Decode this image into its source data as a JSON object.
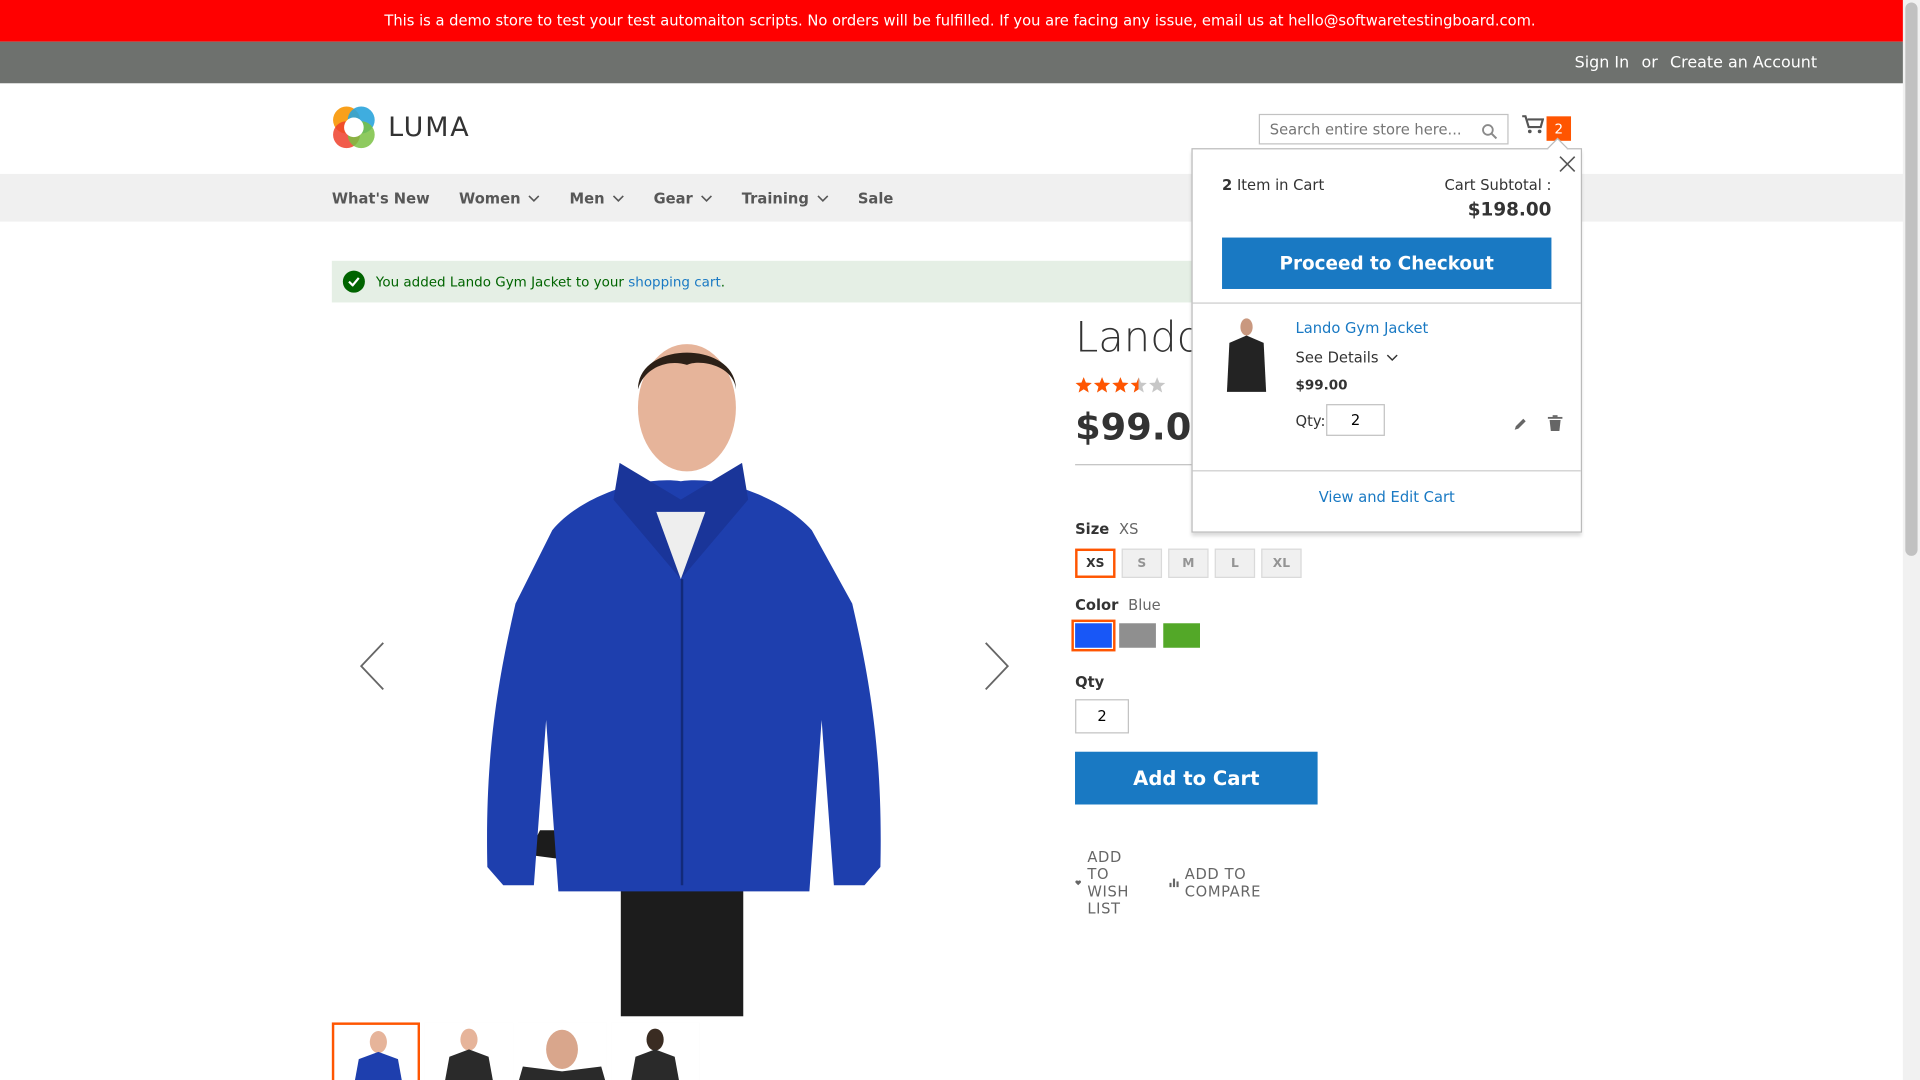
{
  "banner": {
    "text": "This is a demo store to test your test automaiton scripts. No orders will be fulfilled. If you are facing any issue, email us at hello@softwaretestingboard.com."
  },
  "header": {
    "sign_in": "Sign In",
    "or": "or",
    "create_account": "Create an Account",
    "logo_text": "LUMA",
    "search_placeholder": "Search entire store here...",
    "cart_count": "2"
  },
  "nav": {
    "items": [
      {
        "label": "What's New"
      },
      {
        "label": "Women"
      },
      {
        "label": "Men"
      },
      {
        "label": "Gear"
      },
      {
        "label": "Training"
      },
      {
        "label": "Sale"
      }
    ]
  },
  "message": {
    "prefix": "You added Lando Gym Jacket to your ",
    "link": "shopping cart",
    "suffix": "."
  },
  "product": {
    "title": "Lando",
    "rating": 0.7,
    "price": "$99.00",
    "size_label": "Size",
    "size_selected": "XS",
    "sizes": [
      "XS",
      "S",
      "M",
      "L",
      "XL"
    ],
    "color_label": "Color",
    "color_selected": "Blue",
    "colors": [
      "#1857f7",
      "#8f8f8f",
      "#53a828"
    ],
    "qty_label": "Qty",
    "qty_value": "2",
    "add_to_cart": "Add to Cart",
    "wishlist": "ADD TO WISH LIST",
    "compare": "ADD TO COMPARE"
  },
  "minicart": {
    "count": "2",
    "count_suffix": " Item in Cart",
    "subtotal_label": "Cart Subtotal :",
    "subtotal": "$198.00",
    "checkout": "Proceed to Checkout",
    "item_name": "Lando Gym Jacket",
    "see_details": "See Details",
    "item_price": "$99.00",
    "qty_label": "Qty:",
    "qty_value": "2",
    "view_edit": "View and Edit Cart"
  },
  "colors": {
    "accent": "#1979c3",
    "orange": "#ff5501",
    "banner": "#ff0000"
  }
}
